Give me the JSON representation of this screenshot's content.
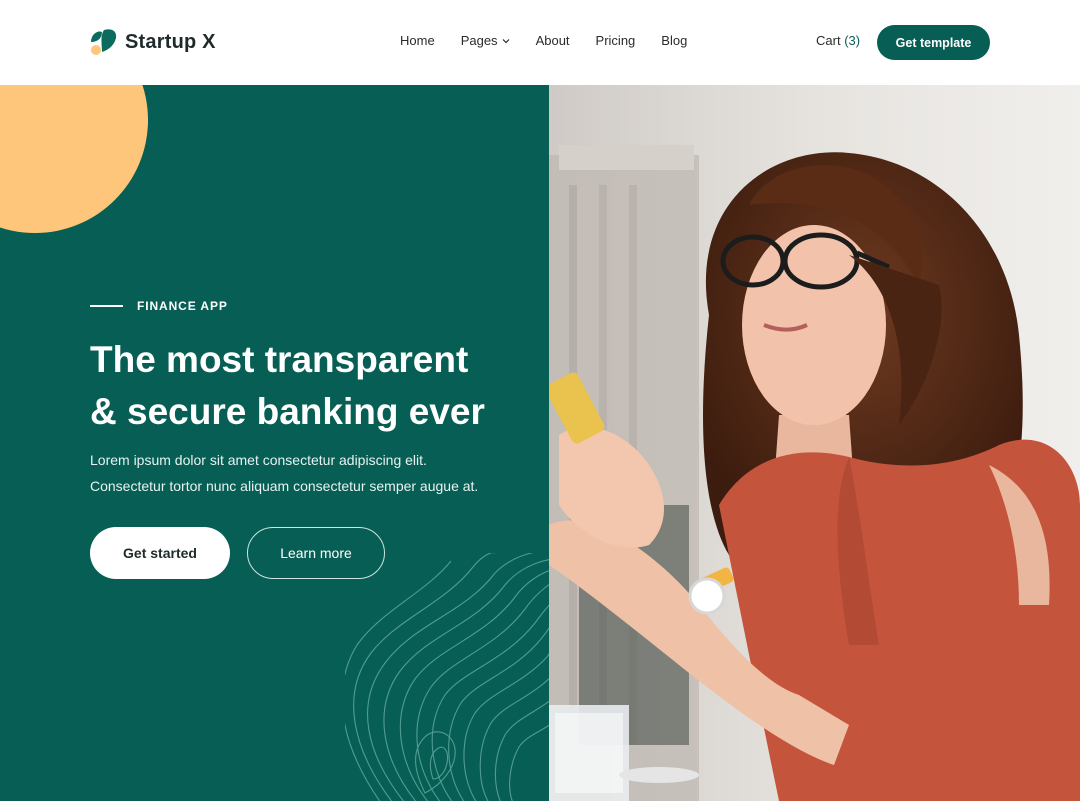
{
  "brand": {
    "name": "Startup X",
    "colors": {
      "primary": "#075e54",
      "accent": "#fec67a",
      "leaf_dark": "#0b6b5e"
    }
  },
  "nav": {
    "items": [
      {
        "label": "Home"
      },
      {
        "label": "Pages",
        "has_dropdown": true
      },
      {
        "label": "About"
      },
      {
        "label": "Pricing"
      },
      {
        "label": "Blog"
      }
    ],
    "cart_label": "Cart",
    "cart_count": "(3)",
    "cta_label": "Get template"
  },
  "hero": {
    "eyebrow": "FINANCE APP",
    "headline_line1": "The most transparent",
    "headline_line2": "& secure banking ever",
    "lead_line1": "Lorem ipsum dolor sit amet consectetur adipiscing elit.",
    "lead_line2": "Consectetur tortor nunc aliquam consectetur semper augue at.",
    "primary_button": "Get started",
    "secondary_button": "Learn more"
  }
}
